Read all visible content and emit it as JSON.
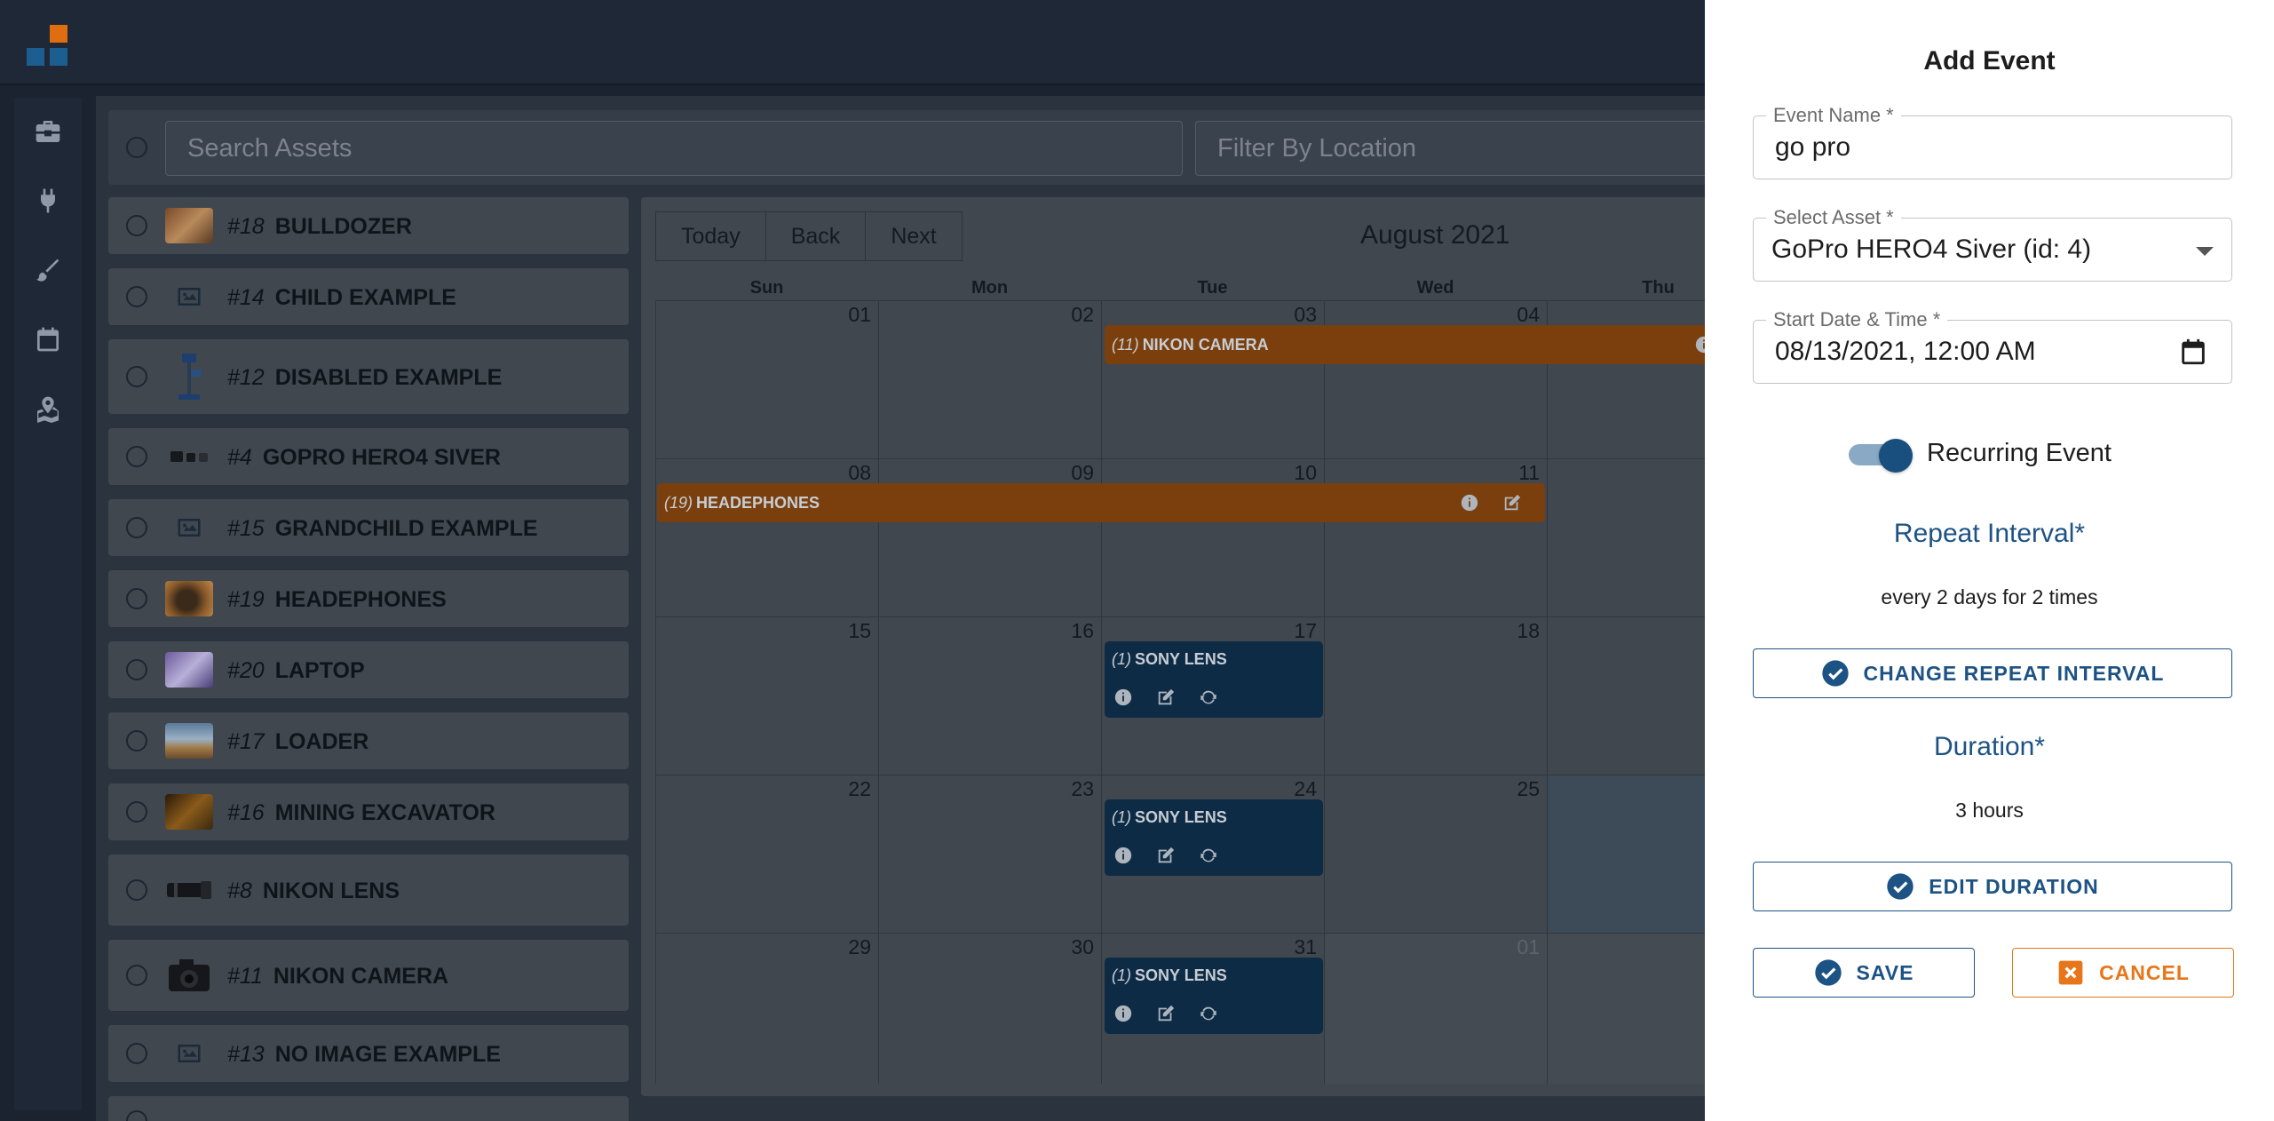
{
  "search": {
    "placeholder": "Search Assets",
    "location_placeholder": "Filter By Location"
  },
  "assets": [
    {
      "num": "#18",
      "name": "BULLDOZER",
      "thumb": "photo"
    },
    {
      "num": "#14",
      "name": "CHILD EXAMPLE",
      "thumb": "image-icon"
    },
    {
      "num": "#12",
      "name": "DISABLED EXAMPLE",
      "thumb": "photo"
    },
    {
      "num": "#4",
      "name": "GOPRO HERO4 SIVER",
      "thumb": "photo"
    },
    {
      "num": "#15",
      "name": "GRANDCHILD EXAMPLE",
      "thumb": "image-icon"
    },
    {
      "num": "#19",
      "name": "HEADEPHONES",
      "thumb": "photo"
    },
    {
      "num": "#20",
      "name": "LAPTOP",
      "thumb": "photo"
    },
    {
      "num": "#17",
      "name": "LOADER",
      "thumb": "photo"
    },
    {
      "num": "#16",
      "name": "MINING EXCAVATOR",
      "thumb": "photo"
    },
    {
      "num": "#8",
      "name": "NIKON LENS",
      "thumb": "photo"
    },
    {
      "num": "#11",
      "name": "NIKON CAMERA",
      "thumb": "photo"
    },
    {
      "num": "#13",
      "name": "NO IMAGE EXAMPLE",
      "thumb": "image-icon"
    }
  ],
  "calendar": {
    "today": "Today",
    "back": "Back",
    "next": "Next",
    "title": "August 2021",
    "dows": [
      "Sun",
      "Mon",
      "Tue",
      "Wed",
      "Thu"
    ],
    "weeks": [
      [
        "01",
        "02",
        "03",
        "04",
        ""
      ],
      [
        "08",
        "09",
        "10",
        "11",
        ""
      ],
      [
        "15",
        "16",
        "17",
        "18",
        ""
      ],
      [
        "22",
        "23",
        "24",
        "25",
        ""
      ],
      [
        "29",
        "30",
        "31",
        "01",
        ""
      ]
    ],
    "events": {
      "nikon": {
        "count": "(11)",
        "name": "NIKON CAMERA"
      },
      "headphones": {
        "count": "(19)",
        "name": "HEADEPHONES"
      },
      "sony1": {
        "count": "(1)",
        "name": "SONY LENS"
      },
      "sony2": {
        "count": "(1)",
        "name": "SONY LENS"
      },
      "sony3": {
        "count": "(1)",
        "name": "SONY LENS"
      }
    }
  },
  "dialog": {
    "title": "Add Event",
    "event_name_label": "Event Name *",
    "event_name_value": "go pro",
    "asset_label": "Select Asset *",
    "asset_value": "GoPro HERO4 Siver (id: 4)",
    "start_label": "Start Date & Time *",
    "start_value": "08/13/2021, 12:00  AM",
    "recurring_label": "Recurring Event",
    "recurring_on": true,
    "repeat_heading": "Repeat Interval*",
    "repeat_value": "every 2 days for 2 times",
    "change_repeat_label": "CHANGE REPEAT INTERVAL",
    "duration_heading": "Duration*",
    "duration_value": "3 hours",
    "edit_duration_label": "EDIT DURATION",
    "save_label": "SAVE",
    "cancel_label": "CANCEL"
  },
  "colors": {
    "accent_blue": "#1d5285",
    "accent_orange": "#e7761a",
    "event_orange": "#7a3f0c",
    "event_blue": "#0e2b45"
  }
}
